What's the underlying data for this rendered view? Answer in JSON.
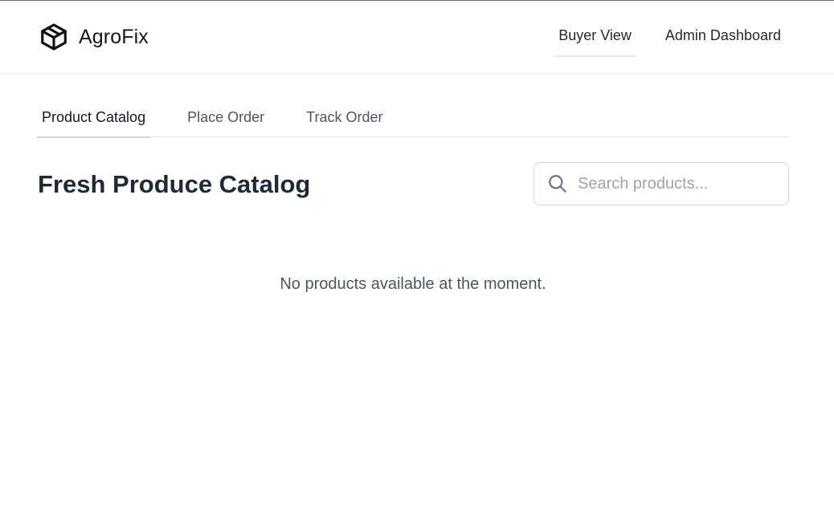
{
  "app": {
    "name": "AgroFix",
    "logo_icon": "package-box-icon"
  },
  "topnav": {
    "items": [
      {
        "label": "Buyer View",
        "active": true
      },
      {
        "label": "Admin Dashboard",
        "active": false
      }
    ]
  },
  "tabs": [
    {
      "label": "Product Catalog",
      "active": true
    },
    {
      "label": "Place Order",
      "active": false
    },
    {
      "label": "Track Order",
      "active": false
    }
  ],
  "main": {
    "title": "Fresh Produce Catalog",
    "search": {
      "placeholder": "Search products...",
      "value": "",
      "icon": "search-icon"
    },
    "empty_message": "No products available at the moment."
  },
  "colors": {
    "text_primary": "#1f2937",
    "text_muted": "#4b5563",
    "placeholder": "#9ca3af",
    "border": "#e5e7eb"
  }
}
